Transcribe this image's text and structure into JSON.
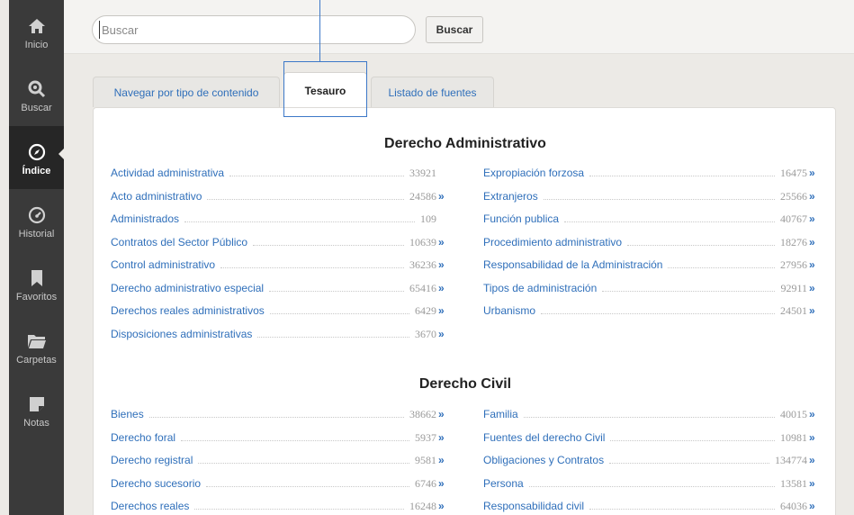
{
  "sidebar": {
    "items": [
      {
        "label": "Inicio",
        "icon": "home-icon"
      },
      {
        "label": "Buscar",
        "icon": "search-icon"
      },
      {
        "label": "Índice",
        "icon": "compass-icon",
        "active": true
      },
      {
        "label": "Historial",
        "icon": "gauge-icon"
      },
      {
        "label": "Favoritos",
        "icon": "bookmark-icon"
      },
      {
        "label": "Carpetas",
        "icon": "folder-icon"
      },
      {
        "label": "Notas",
        "icon": "note-icon"
      }
    ]
  },
  "search": {
    "placeholder": "Buscar",
    "button_label": "Buscar"
  },
  "tabs": [
    {
      "label": "Navegar por tipo de contenido"
    },
    {
      "label": "Tesauro",
      "active": true
    },
    {
      "label": "Listado de fuentes"
    }
  ],
  "sections": [
    {
      "title": "Derecho Administrativo",
      "left": [
        {
          "label": "Actividad administrativa",
          "count": "33921",
          "arrow": ""
        },
        {
          "label": "Acto administrativo",
          "count": "24586",
          "arrow": "»"
        },
        {
          "label": "Administrados",
          "count": "109",
          "arrow": ""
        },
        {
          "label": "Contratos del Sector Público",
          "count": "10639",
          "arrow": "»"
        },
        {
          "label": "Control administrativo",
          "count": "36236",
          "arrow": "»"
        },
        {
          "label": "Derecho administrativo especial",
          "count": "65416",
          "arrow": "»"
        },
        {
          "label": "Derechos reales administrativos",
          "count": "6429",
          "arrow": "»"
        },
        {
          "label": "Disposiciones administrativas",
          "count": "3670",
          "arrow": "»"
        }
      ],
      "right": [
        {
          "label": "Expropiación forzosa",
          "count": "16475",
          "arrow": "»"
        },
        {
          "label": "Extranjeros",
          "count": "25566",
          "arrow": "»"
        },
        {
          "label": "Función publica",
          "count": "40767",
          "arrow": "»"
        },
        {
          "label": "Procedimiento administrativo",
          "count": "18276",
          "arrow": "»"
        },
        {
          "label": "Responsabilidad de la Administración",
          "count": "27956",
          "arrow": "»"
        },
        {
          "label": "Tipos de administración",
          "count": "92911",
          "arrow": "»"
        },
        {
          "label": "Urbanismo",
          "count": "24501",
          "arrow": "»"
        }
      ]
    },
    {
      "title": "Derecho Civil",
      "left": [
        {
          "label": "Bienes",
          "count": "38662",
          "arrow": "»"
        },
        {
          "label": "Derecho foral",
          "count": "5937",
          "arrow": "»"
        },
        {
          "label": "Derecho registral",
          "count": "9581",
          "arrow": "»"
        },
        {
          "label": "Derecho sucesorio",
          "count": "6746",
          "arrow": "»"
        },
        {
          "label": "Derechos reales",
          "count": "16248",
          "arrow": "»"
        }
      ],
      "right": [
        {
          "label": "Familia",
          "count": "40015",
          "arrow": "»"
        },
        {
          "label": "Fuentes del derecho Civil",
          "count": "10981",
          "arrow": "»"
        },
        {
          "label": "Obligaciones y Contratos",
          "count": "134774",
          "arrow": "»"
        },
        {
          "label": "Persona",
          "count": "13581",
          "arrow": "»"
        },
        {
          "label": "Responsabilidad civil",
          "count": "64036",
          "arrow": "»"
        }
      ]
    }
  ],
  "colors": {
    "sidebar_bg": "#3a3a3a",
    "sidebar_active_bg": "#262626",
    "link": "#2f6fba",
    "count": "#9a9a9a",
    "highlight": "#3c78c8"
  }
}
